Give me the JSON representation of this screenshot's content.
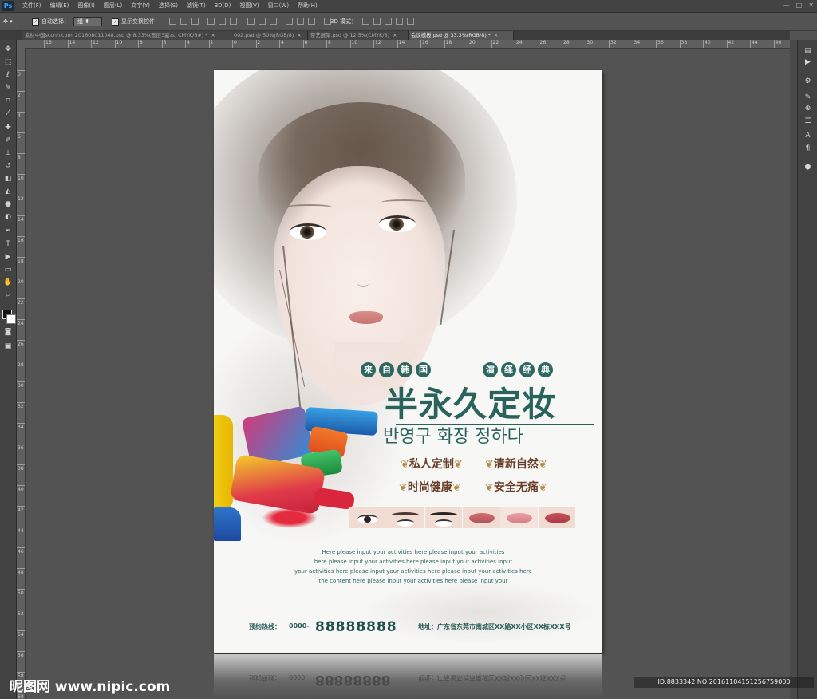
{
  "app": {
    "logo": "Ps",
    "menus": [
      "文件(F)",
      "编辑(E)",
      "图像(I)",
      "图层(L)",
      "文字(Y)",
      "选择(S)",
      "滤镜(T)",
      "3D(D)",
      "视图(V)",
      "窗口(W)",
      "帮助(H)"
    ]
  },
  "options": {
    "auto_select_label": "自动选择：",
    "auto_select_value": "组",
    "transform_label": "显示变换控件",
    "mode_3d_label": "3D 模式："
  },
  "tabs": [
    {
      "label": "素材中国sccnn.com_20160801104​8.psd @ 8.33%(图层3副本, CMYK/8#) *",
      "active": false
    },
    {
      "label": "002.psd @ 50%(RGB/8)",
      "active": false
    },
    {
      "label": "茶艺展架.psd @ 12.5%(CMYK/8)",
      "active": false
    },
    {
      "label": "会议模板.psd @ 33.3%(RGB/8) *",
      "active": true
    }
  ],
  "ruler": {
    "h_labels": [
      "16",
      "14",
      "12",
      "10",
      "8",
      "6",
      "4",
      "2",
      "0",
      "2",
      "4",
      "6",
      "8",
      "10",
      "12",
      "14",
      "16",
      "18",
      "20",
      "22",
      "24",
      "26",
      "28",
      "30",
      "32",
      "34",
      "36",
      "38",
      "40",
      "42",
      "44",
      "46",
      "48"
    ],
    "v_labels": [
      "0",
      "2",
      "4",
      "6",
      "8",
      "10",
      "12",
      "14",
      "16",
      "18",
      "20",
      "22",
      "24",
      "26",
      "28",
      "30",
      "32",
      "34",
      "36",
      "38",
      "40",
      "42",
      "44",
      "46",
      "48",
      "50",
      "52",
      "54",
      "56",
      "58",
      "60"
    ]
  },
  "poster": {
    "subheading_left": [
      "来",
      "自",
      "韩",
      "国"
    ],
    "subheading_right": [
      "演",
      "绎",
      "经",
      "典"
    ],
    "title": "半永久定妆",
    "korean": "반영구 화장 정하다",
    "features": [
      "私人定制",
      "清新自然",
      "时尚健康",
      "安全无痛"
    ],
    "paragraph": [
      "Here please input your activities here please input your activities",
      "here please input your activities here please input your activities input",
      "your activities here please input your activities here please input your activities here",
      "the content here please input your activities here please input your"
    ],
    "hotline_label": "预约热线：",
    "hotline_prefix": "0000-",
    "hotline_number": "88888888",
    "address": "地址：广东省东莞市南城区XX路XX小区XX栋XXX号"
  },
  "watermark": {
    "logo_text": "昵图网 www.nipic.com",
    "id_text": "ID:8833342 NO:20161104151256759000"
  },
  "colors": {
    "accent_teal": "#2a625c",
    "feature_brown": "#6a3f2a",
    "ui_dark": "#535353"
  }
}
